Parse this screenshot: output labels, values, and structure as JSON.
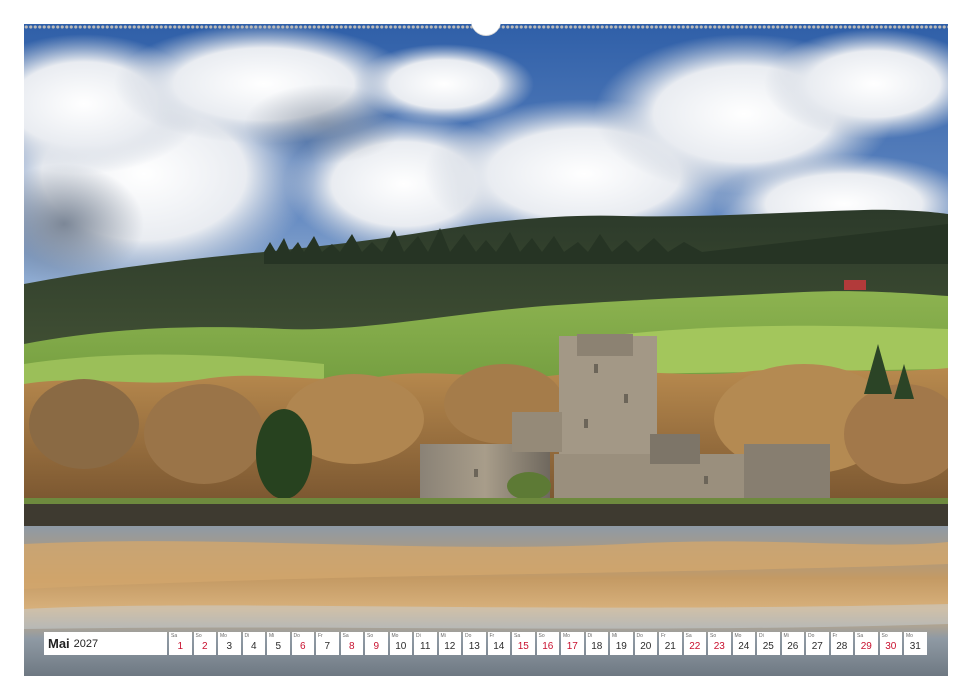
{
  "calendar": {
    "month": "Mai",
    "year": "2027",
    "days": [
      {
        "d": "1",
        "wd": "Sa",
        "weekend": true
      },
      {
        "d": "2",
        "wd": "So",
        "weekend": true
      },
      {
        "d": "3",
        "wd": "Mo",
        "weekend": false
      },
      {
        "d": "4",
        "wd": "Di",
        "weekend": false
      },
      {
        "d": "5",
        "wd": "Mi",
        "weekend": false
      },
      {
        "d": "6",
        "wd": "Do",
        "weekend": true
      },
      {
        "d": "7",
        "wd": "Fr",
        "weekend": false
      },
      {
        "d": "8",
        "wd": "Sa",
        "weekend": true
      },
      {
        "d": "9",
        "wd": "So",
        "weekend": true
      },
      {
        "d": "10",
        "wd": "Mo",
        "weekend": false
      },
      {
        "d": "11",
        "wd": "Di",
        "weekend": false
      },
      {
        "d": "12",
        "wd": "Mi",
        "weekend": false
      },
      {
        "d": "13",
        "wd": "Do",
        "weekend": false
      },
      {
        "d": "14",
        "wd": "Fr",
        "weekend": false
      },
      {
        "d": "15",
        "wd": "Sa",
        "weekend": true
      },
      {
        "d": "16",
        "wd": "So",
        "weekend": true
      },
      {
        "d": "17",
        "wd": "Mo",
        "weekend": true
      },
      {
        "d": "18",
        "wd": "Di",
        "weekend": false
      },
      {
        "d": "19",
        "wd": "Mi",
        "weekend": false
      },
      {
        "d": "20",
        "wd": "Do",
        "weekend": false
      },
      {
        "d": "21",
        "wd": "Fr",
        "weekend": false
      },
      {
        "d": "22",
        "wd": "Sa",
        "weekend": true
      },
      {
        "d": "23",
        "wd": "So",
        "weekend": true
      },
      {
        "d": "24",
        "wd": "Mo",
        "weekend": false
      },
      {
        "d": "25",
        "wd": "Di",
        "weekend": false
      },
      {
        "d": "26",
        "wd": "Mi",
        "weekend": false
      },
      {
        "d": "27",
        "wd": "Do",
        "weekend": false
      },
      {
        "d": "28",
        "wd": "Fr",
        "weekend": false
      },
      {
        "d": "29",
        "wd": "Sa",
        "weekend": true
      },
      {
        "d": "30",
        "wd": "So",
        "weekend": true
      },
      {
        "d": "31",
        "wd": "Mo",
        "weekend": false
      }
    ]
  },
  "colors": {
    "weekend": "#c8102e",
    "weekday": "#2c2c2c"
  }
}
